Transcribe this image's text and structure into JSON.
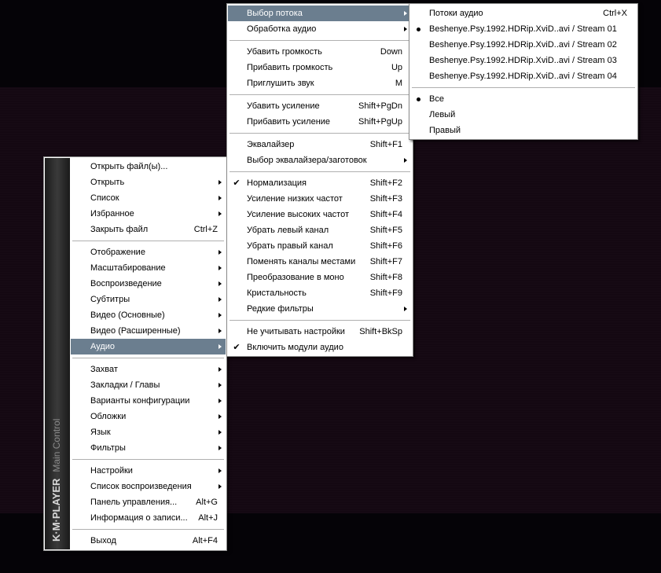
{
  "main_menu": {
    "brand": "K·M·PLAYER",
    "brand_sub": "Main Control",
    "items": [
      {
        "label": "Открыть файл(ы)...",
        "shortcut": "",
        "arrow": false
      },
      {
        "label": "Открыть",
        "shortcut": "",
        "arrow": true
      },
      {
        "label": "Список",
        "shortcut": "",
        "arrow": true
      },
      {
        "label": "Избранное",
        "shortcut": "",
        "arrow": true
      },
      {
        "label": "Закрыть файл",
        "shortcut": "Ctrl+Z",
        "arrow": false
      },
      {
        "label": "Отображение",
        "shortcut": "",
        "arrow": true
      },
      {
        "label": "Масштабирование",
        "shortcut": "",
        "arrow": true
      },
      {
        "label": "Воспроизведение",
        "shortcut": "",
        "arrow": true
      },
      {
        "label": "Субтитры",
        "shortcut": "",
        "arrow": true
      },
      {
        "label": "Видео (Основные)",
        "shortcut": "",
        "arrow": true
      },
      {
        "label": "Видео (Расширенные)",
        "shortcut": "",
        "arrow": true
      },
      {
        "label": "Аудио",
        "shortcut": "",
        "arrow": true,
        "highlight": true
      },
      {
        "label": "Захват",
        "shortcut": "",
        "arrow": true
      },
      {
        "label": "Закладки / Главы",
        "shortcut": "",
        "arrow": true
      },
      {
        "label": "Варианты конфигурации",
        "shortcut": "",
        "arrow": true
      },
      {
        "label": "Обложки",
        "shortcut": "",
        "arrow": true
      },
      {
        "label": "Язык",
        "shortcut": "",
        "arrow": true
      },
      {
        "label": "Фильтры",
        "shortcut": "",
        "arrow": true
      },
      {
        "label": "Настройки",
        "shortcut": "",
        "arrow": true
      },
      {
        "label": "Список воспроизведения",
        "shortcut": "",
        "arrow": true
      },
      {
        "label": "Панель управления...",
        "shortcut": "Alt+G",
        "arrow": false
      },
      {
        "label": "Информация о записи...",
        "shortcut": "Alt+J",
        "arrow": false
      },
      {
        "label": "Выход",
        "shortcut": "Alt+F4",
        "arrow": false
      }
    ]
  },
  "audio_menu": {
    "items": [
      {
        "label": "Выбор потока",
        "shortcut": "",
        "arrow": true,
        "highlight": true
      },
      {
        "label": "Обработка аудио",
        "shortcut": "",
        "arrow": true
      },
      {
        "label": "Убавить громкость",
        "shortcut": "Down"
      },
      {
        "label": "Прибавить громкость",
        "shortcut": "Up"
      },
      {
        "label": "Приглушить звук",
        "shortcut": "M"
      },
      {
        "label": "Убавить усиление",
        "shortcut": "Shift+PgDn"
      },
      {
        "label": "Прибавить усиление",
        "shortcut": "Shift+PgUp"
      },
      {
        "label": "Эквалайзер",
        "shortcut": "Shift+F1"
      },
      {
        "label": "Выбор эквалайзера/заготовок",
        "shortcut": "",
        "arrow": true
      },
      {
        "label": "Нормализация",
        "shortcut": "Shift+F2",
        "checked": true
      },
      {
        "label": "Усиление низких частот",
        "shortcut": "Shift+F3"
      },
      {
        "label": "Усиление высоких частот",
        "shortcut": "Shift+F4"
      },
      {
        "label": "Убрать левый канал",
        "shortcut": "Shift+F5"
      },
      {
        "label": "Убрать правый канал",
        "shortcut": "Shift+F6"
      },
      {
        "label": "Поменять каналы местами",
        "shortcut": "Shift+F7"
      },
      {
        "label": "Преобразование в моно",
        "shortcut": "Shift+F8"
      },
      {
        "label": "Кристальность",
        "shortcut": "Shift+F9"
      },
      {
        "label": "Редкие фильтры",
        "shortcut": "",
        "arrow": true
      },
      {
        "label": "Не учитывать настройки",
        "shortcut": "Shift+BkSp"
      },
      {
        "label": "Включить модули аудио",
        "shortcut": "",
        "checked": true
      }
    ]
  },
  "stream_menu": {
    "items": [
      {
        "label": "Потоки аудио",
        "shortcut": "Ctrl+X"
      },
      {
        "label": "Beshenye.Psy.1992.HDRip.XviD..avi / Stream 01",
        "selected": true
      },
      {
        "label": "Beshenye.Psy.1992.HDRip.XviD..avi / Stream 02"
      },
      {
        "label": "Beshenye.Psy.1992.HDRip.XviD..avi / Stream 03"
      },
      {
        "label": "Beshenye.Psy.1992.HDRip.XviD..avi / Stream 04"
      },
      {
        "label": "Все",
        "selected": true
      },
      {
        "label": "Левый"
      },
      {
        "label": "Правый"
      }
    ]
  }
}
